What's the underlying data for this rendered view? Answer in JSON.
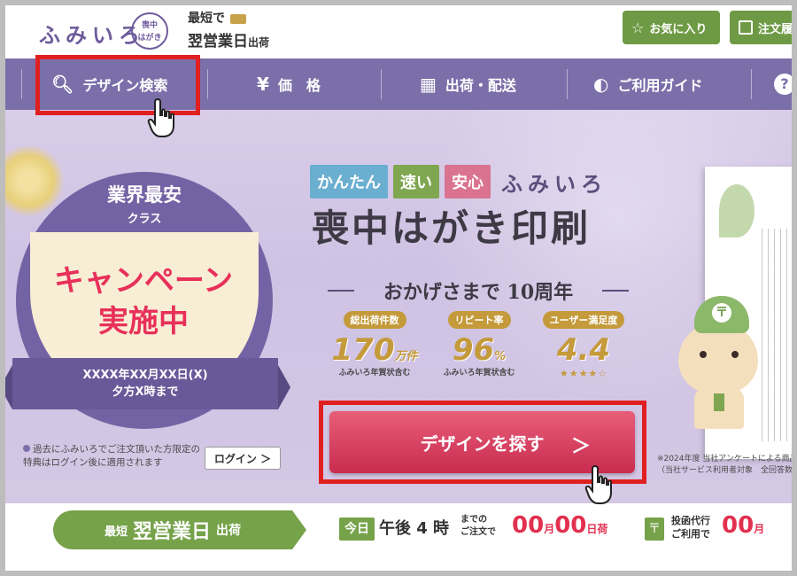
{
  "header": {
    "logo_text": "ふみいろ",
    "logo_badge": "喪中\nはがき",
    "ship_top": "最短で",
    "ship_bottom_main": "翌営業日",
    "ship_bottom_small": "出荷",
    "favorites_label": "お気に入り",
    "order_label": "注文履"
  },
  "nav": {
    "items": [
      {
        "label": "デザイン検索",
        "icon": "search-icon"
      },
      {
        "label": "価　格",
        "icon": "yen-icon"
      },
      {
        "label": "出荷・配送",
        "icon": "calendar-icon"
      },
      {
        "label": "ご利用ガイド",
        "icon": "shield-icon"
      },
      {
        "label": "?",
        "icon": "help-icon"
      }
    ]
  },
  "badge": {
    "title": "業界最安",
    "sub": "クラス",
    "campaign_line1": "キャンペーン",
    "campaign_line2": "実施中",
    "ribbon_line1": "XXXX年XX月XX日(X)",
    "ribbon_line2": "夕方X時まで"
  },
  "login": {
    "note": "過去にふみいろでご注文頂いた方限定の特典はログイン後に適用されます",
    "button": "ログイン ＞"
  },
  "hero": {
    "tag1": "かんたん",
    "tag2": "速い",
    "tag3": "安心",
    "brand": "ふみいろ",
    "title": "喪中はがき印刷",
    "anniversary": "おかげさまで 10周年",
    "stats": [
      {
        "label": "総出荷件数",
        "value": "170",
        "unit": "万件",
        "note": "ふみいろ年賀状含む"
      },
      {
        "label": "リピート率",
        "value": "96",
        "unit": "%",
        "note": "ふみいろ年賀状含む"
      },
      {
        "label": "ユーザー満足度",
        "value": "4.4",
        "unit": "",
        "note": "★★★★☆"
      }
    ],
    "cta": "デザインを探す",
    "cta_arrow": "＞",
    "survey_note_1": "※2024年度 当社アンケートによる商品",
    "survey_note_2": "（当社サービス利用者対象　全回答数",
    "mascot_mark": "〒"
  },
  "shipbar": {
    "pill_small": "最短",
    "pill_main": "翌営業日",
    "pill_tail": "出荷",
    "today_tag": "今日",
    "today_text": "午後 4 時",
    "today_small_1": "までの",
    "today_small_2": "ご注文で",
    "count1_num1": "00",
    "count1_unit1": "月",
    "count1_num2": "00",
    "count1_unit2": "日荷",
    "post_icon": "〒",
    "post_text_1": "投函代行",
    "post_text_2": "ご利用で",
    "count2_num": "00",
    "count2_unit": "月"
  }
}
